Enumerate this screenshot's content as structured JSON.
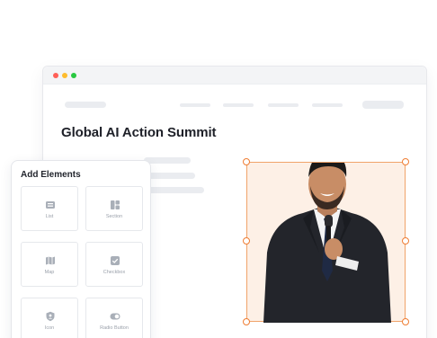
{
  "page": {
    "title": "Global AI Action Summit"
  },
  "panel": {
    "title": "Add Elements",
    "tiles": [
      {
        "label": "List",
        "icon": "list-icon"
      },
      {
        "label": "Section",
        "icon": "section-icon"
      },
      {
        "label": "Map",
        "icon": "map-icon"
      },
      {
        "label": "Checkbox",
        "icon": "checkbox-icon"
      },
      {
        "label": "Icon",
        "icon": "shield-icon"
      },
      {
        "label": "Radio Button",
        "icon": "radio-button-icon"
      }
    ]
  },
  "colors": {
    "accent": "#ef7d33",
    "frame_fill": "#fdf0e6",
    "placeholder": "#eaecf0",
    "icon_gray": "#a9afb8"
  }
}
